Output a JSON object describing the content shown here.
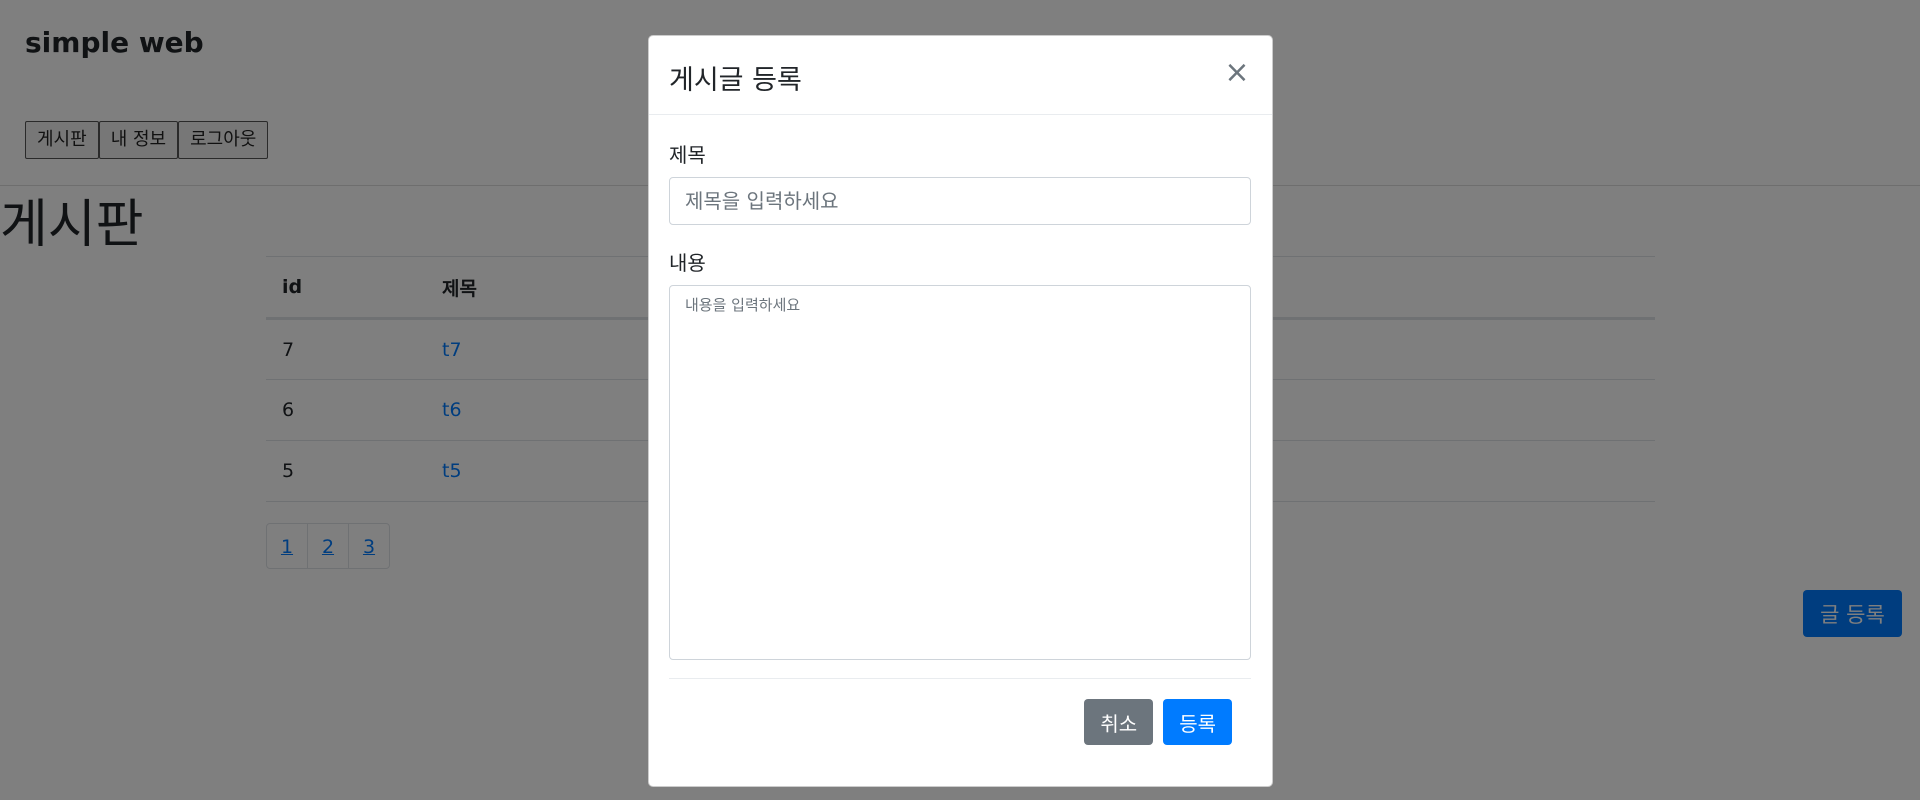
{
  "site": {
    "title": "simple web"
  },
  "nav": {
    "items": [
      "게시판",
      "내 정보",
      "로그아웃"
    ]
  },
  "board": {
    "heading": "게시판",
    "columns": [
      "id",
      "제목"
    ],
    "rows": [
      {
        "id": "7",
        "title": "t7"
      },
      {
        "id": "6",
        "title": "t6"
      },
      {
        "id": "5",
        "title": "t5"
      }
    ],
    "pages": [
      "1",
      "2",
      "3"
    ],
    "write_button": "글 등록"
  },
  "modal": {
    "title": "게시글 등록",
    "close_glyph": "×",
    "title_label": "제목",
    "title_placeholder": "제목을 입력하세요",
    "content_label": "내용",
    "content_placeholder": "내용을 입력하세요",
    "cancel_label": "취소",
    "submit_label": "등록"
  },
  "colors": {
    "primary": "#007bff",
    "secondary": "#6c757d",
    "backdrop": "rgba(0,0,0,0.5)"
  }
}
